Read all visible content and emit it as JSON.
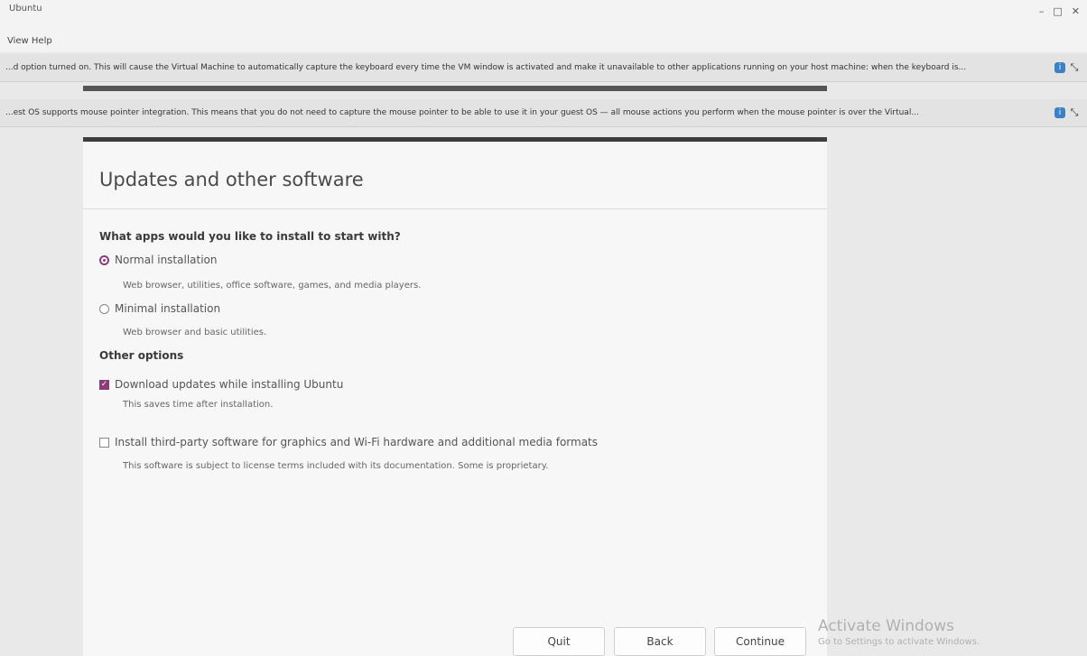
{
  "window": {
    "title": "Ubuntu",
    "menu": "View  Help"
  },
  "notices": [
    {
      "text": "...d option turned on. This will cause the Virtual Machine to automatically capture the keyboard every time the VM window is activated and make it unavailable to other applications running on your host machine: when the keyboard is..."
    },
    {
      "text": "...est OS supports mouse pointer integration. This means that you do not need to capture the mouse pointer to be able to use it in your guest OS — all mouse actions you perform when the mouse pointer is over the Virtual..."
    }
  ],
  "installer": {
    "header_title": "Updates and other software",
    "question": "What apps would you like to install to start with?",
    "options": [
      {
        "label": "Normal installation",
        "desc": "Web browser, utilities, office software, games, and media players.",
        "selected": true
      },
      {
        "label": "Minimal installation",
        "desc": "Web browser and basic utilities.",
        "selected": false
      }
    ],
    "other_options_title": "Other options",
    "checkboxes": [
      {
        "label": "Download updates while installing Ubuntu",
        "desc": "This saves time after installation.",
        "checked": true
      },
      {
        "label": "Install third-party software for graphics and Wi-Fi hardware and additional media formats",
        "desc": "This software is subject to license terms included with its documentation. Some is proprietary.",
        "checked": false
      }
    ],
    "buttons": {
      "quit": "Quit",
      "back": "Back",
      "continue": "Continue"
    }
  },
  "activation": {
    "title": "Activate Windows",
    "subtitle": "Go to Settings to activate Windows."
  },
  "colors": {
    "accent": "#8a3b78",
    "info_icon": "#3b82c4"
  }
}
